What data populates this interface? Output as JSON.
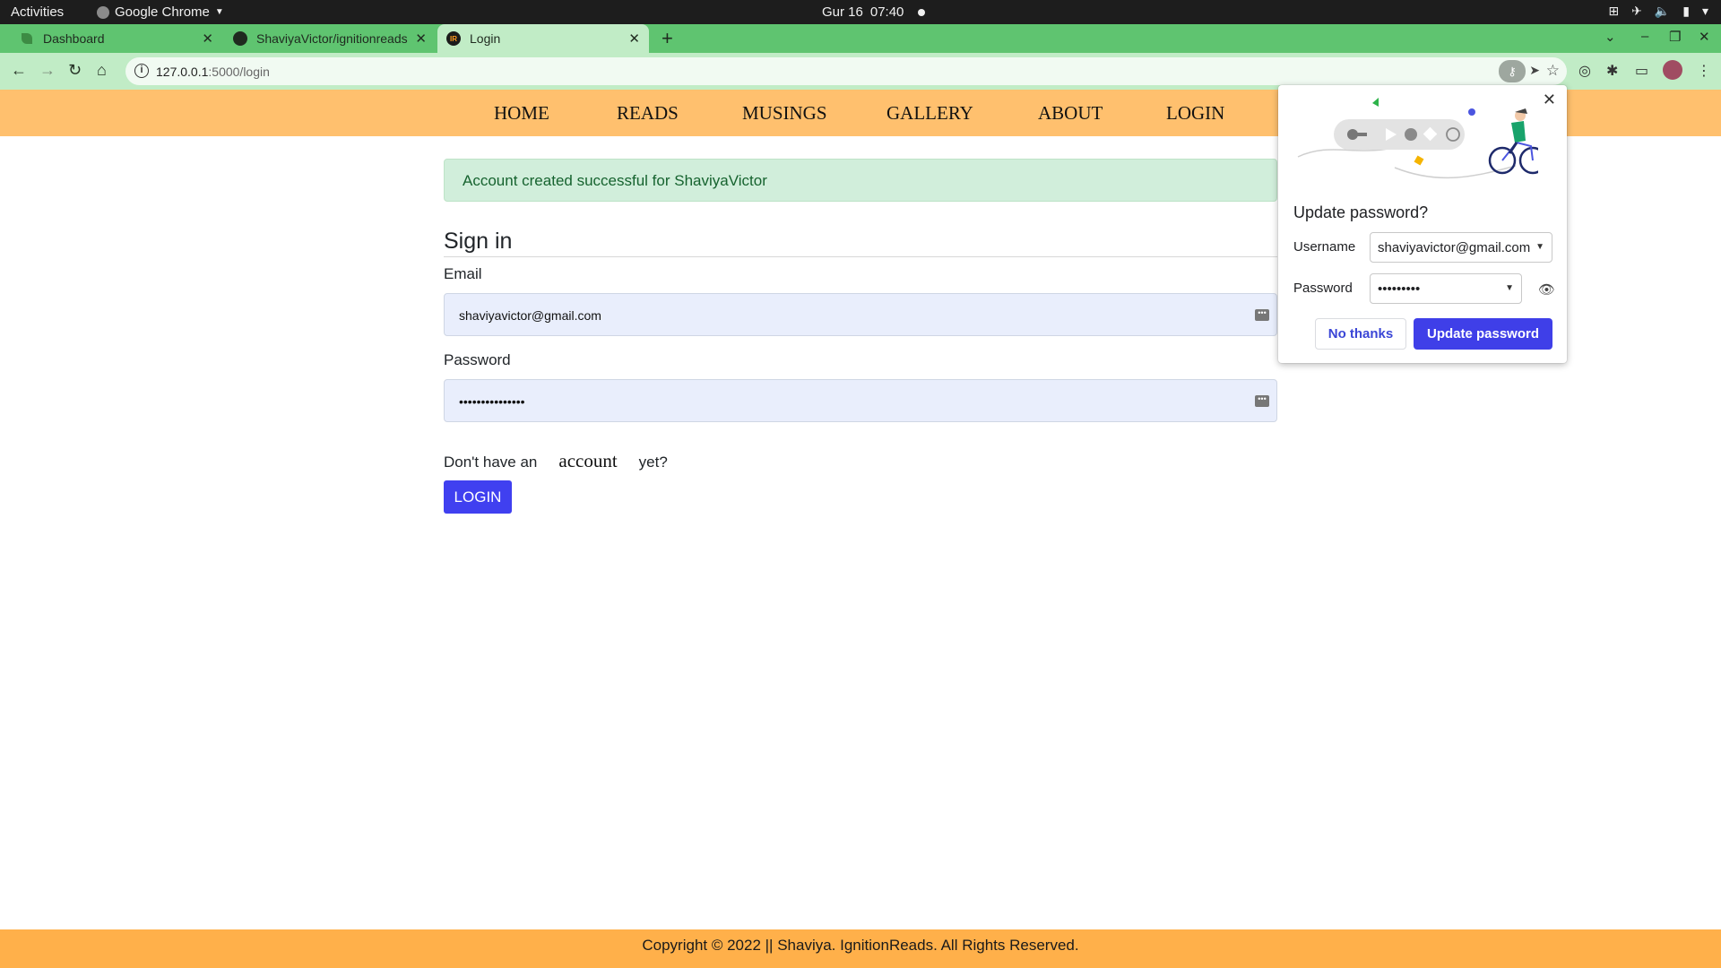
{
  "topbar": {
    "activities": "Activities",
    "app_name": "Google Chrome",
    "date": "Gur 16",
    "time": "07:40"
  },
  "tabs": [
    {
      "title": "Dashboard",
      "favicon": "leaf-icon"
    },
    {
      "title": "ShaviyaVictor/ignitionreads",
      "favicon": "github-icon"
    },
    {
      "title": "Login",
      "favicon": "ir-logo-icon",
      "active": true
    }
  ],
  "omnibox": {
    "host": "127.0.0.1",
    "path": ":5000/login"
  },
  "site_nav": {
    "links": [
      "HOME",
      "READS",
      "MUSINGS",
      "GALLERY",
      "ABOUT",
      "LOGIN"
    ]
  },
  "flash": {
    "message": "Account created successful for ShaviyaVictor"
  },
  "form": {
    "title": "Sign in",
    "email_label": "Email",
    "email_value": "shaviyavictor@gmail.com",
    "password_label": "Password",
    "password_value": "•••••••••••••••",
    "signup_prefix": "Don't have an",
    "signup_link": "account",
    "signup_suffix": "yet?",
    "submit_label": "LOGIN"
  },
  "footer": {
    "text": "Copyright © 2022 || Shaviya. IgnitionReads. All Rights Reserved."
  },
  "password_bubble": {
    "heading": "Update password?",
    "username_label": "Username",
    "username_value": "shaviyavictor@gmail.com",
    "password_label": "Password",
    "password_value": "•••••••••",
    "no_thanks_label": "No thanks",
    "update_label": "Update password"
  },
  "colors": {
    "tabstrip": "#5fc470",
    "toolbar": "#c1ecc6",
    "navbar": "#ffc06e",
    "footer": "#ffb04a",
    "flash_bg": "#d1eedb",
    "button_primary": "#4040f0"
  }
}
